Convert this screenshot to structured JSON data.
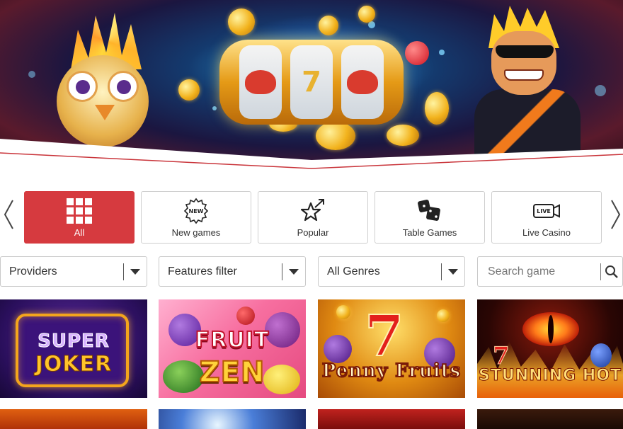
{
  "nav": {
    "prev_icon": "chevron-left-icon",
    "next_icon": "chevron-right-icon"
  },
  "categories": [
    {
      "label": "All",
      "icon": "grid-icon",
      "active": true
    },
    {
      "label": "New games",
      "icon": "new-badge-icon",
      "active": false
    },
    {
      "label": "Popular",
      "icon": "star-arrow-icon",
      "active": false
    },
    {
      "label": "Table Games",
      "icon": "dice-icon",
      "active": false
    },
    {
      "label": "Live Casino",
      "icon": "live-camera-icon",
      "active": false
    }
  ],
  "filters": {
    "providers": "Providers",
    "features": "Features filter",
    "genres": "All Genres"
  },
  "search": {
    "placeholder": "Search game",
    "icon": "search-icon"
  },
  "games": [
    {
      "line1": "SUPER",
      "line2": "JOKER"
    },
    {
      "line1": "FRUIT",
      "line2": "ZEN"
    },
    {
      "line1": "Penny Fruits",
      "seven": "7"
    },
    {
      "line1": "STUNNING HOT",
      "seven": "7"
    }
  ],
  "colors": {
    "accent": "#d63a3f",
    "border": "#cfcfcf",
    "text": "#333333"
  }
}
